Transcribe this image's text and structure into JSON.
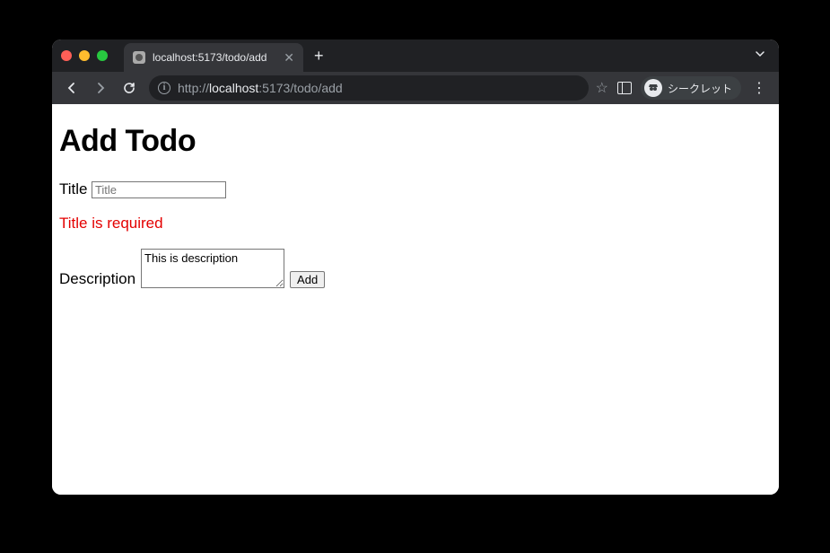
{
  "browser": {
    "tab_title": "localhost:5173/todo/add",
    "url_scheme": "http://",
    "url_host": "localhost",
    "url_path": ":5173/todo/add",
    "incognito_label": "シークレット"
  },
  "page": {
    "heading": "Add Todo",
    "title_label": "Title",
    "title_placeholder": "Title",
    "title_value": "",
    "title_error": "Title is required",
    "description_label": "Description",
    "description_value": "This is description",
    "submit_label": "Add"
  }
}
